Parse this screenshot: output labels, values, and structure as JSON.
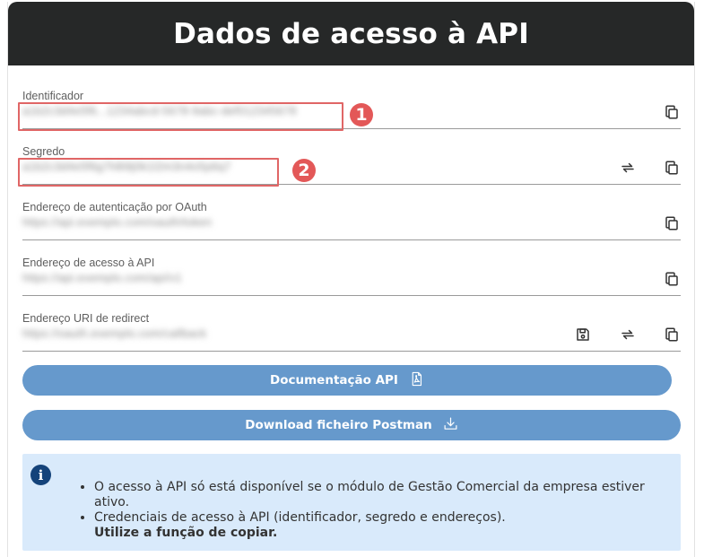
{
  "dialog": {
    "title": "Dados de acesso à API"
  },
  "fields": [
    {
      "label": "Identificador",
      "value": "a1b2c3d4e5f6...1234abcd-5678-9abc-def012345678",
      "marker": "1"
    },
    {
      "label": "Segredo",
      "value": "a1b2c3d4e5f6g7h8i9j0k1l2m3n4o5p6q7",
      "marker": "2"
    },
    {
      "label": "Endereço de autenticação por OAuth",
      "value": "https://api.exemplo.com/oauth/token"
    },
    {
      "label": "Endereço de acesso à API",
      "value": "https://api.exemplo.com/api/v1"
    },
    {
      "label": "Endereço URI de redirect",
      "value": "https://oauth.exemplo.com/callback"
    }
  ],
  "buttons": {
    "docs": "Documentação API",
    "postman": "Download ficheiro Postman"
  },
  "info": {
    "items": [
      "O acesso à API só está disponível se o módulo de Gestão Comercial da empresa estiver ativo.",
      "Credenciais de acesso à API (identificador, segredo e endereços)."
    ],
    "emphasis": "Utilize a função de copiar."
  },
  "icons": {
    "copy": "copy-icon",
    "refresh": "refresh-icon",
    "save": "save-icon",
    "pdf": "pdf-file-icon",
    "download": "download-icon",
    "info": "info-icon"
  },
  "colors": {
    "header_bg": "#262828",
    "button_bg": "#6699cc",
    "info_bg": "#d9eafb",
    "highlight": "#e06666",
    "info_icon": "#14437a"
  }
}
